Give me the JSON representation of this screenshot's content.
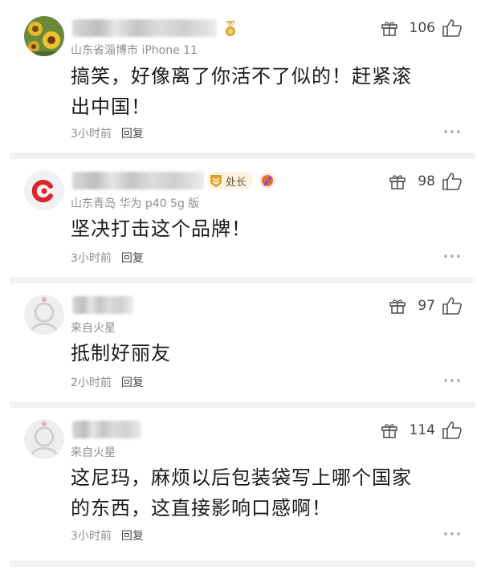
{
  "comments": [
    {
      "location": "山东省淄博市 iPhone 11",
      "text_line1": "搞笑，好像离了你活不了似的！赶紧滚",
      "text_line2": "出中国！",
      "time": "3小时前",
      "reply": "回复",
      "likes": "106",
      "avatar": "sunflower-photo"
    },
    {
      "location": "山东青岛 华为 p40 5g 版",
      "rank_badge": "处长",
      "text_line1": "坚决打击这个品牌！",
      "time": "3小时前",
      "reply": "回复",
      "likes": "98",
      "avatar": "red-logo"
    },
    {
      "location": "来自火星",
      "text_line1": "抵制好丽友",
      "time": "2小时前",
      "reply": "回复",
      "likes": "97",
      "avatar": "default-gray"
    },
    {
      "location": "来自火星",
      "text_line1": "这尼玛，麻烦以后包装袋写上哪个国家",
      "text_line2": "的东西，这直接影响口感啊！",
      "time": "3小时前",
      "reply": "回复",
      "likes": "114",
      "avatar": "default-gray"
    }
  ],
  "colors": {
    "text": "#1a1a1a",
    "meta": "#8d8d8d",
    "badge_bg": "#fbf3e2",
    "badge_gold": "#d9a520"
  }
}
